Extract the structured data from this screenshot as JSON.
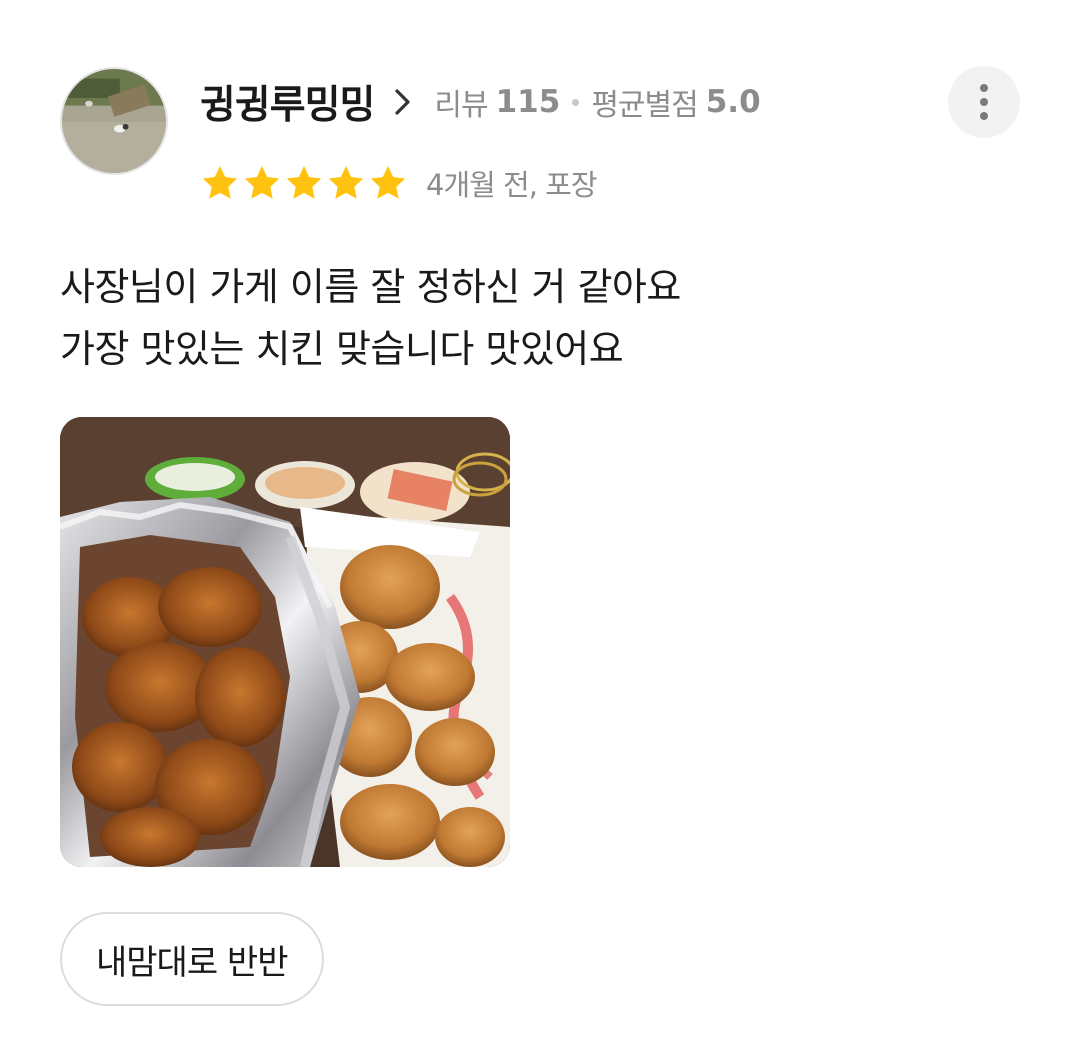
{
  "reviewer": {
    "nickname": "귕귕루밍밍",
    "review_count_label": "리뷰",
    "review_count": "115",
    "avg_rating_label": "평균별점",
    "avg_rating": "5.0",
    "avatar_icon": "profile-photo"
  },
  "rating": {
    "stars": 5,
    "max_stars": 5,
    "star_color": "#FFC20E",
    "date_text": "4개월 전, 포장"
  },
  "review": {
    "lines": [
      "사장님이 가게 이름 잘 정하신 거 같아요",
      "가장 맛있는 치킨 맞습니다 맛있어요"
    ]
  },
  "photo": {
    "description_icon": "fried-chicken-photo"
  },
  "menu_tags": [
    "내맘대로 반반"
  ],
  "actions": {
    "more_icon": "more-vertical-icon"
  }
}
